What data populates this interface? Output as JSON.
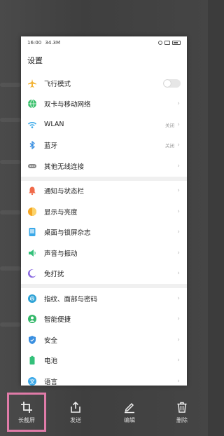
{
  "status_bar": {
    "time": "16:00",
    "extra": "34.3M"
  },
  "page_title": "设置",
  "groups": [
    [
      {
        "icon": "airplane-icon",
        "label": "飞行模式",
        "value": "",
        "control": "toggle",
        "color": "#f2b233"
      },
      {
        "icon": "globe-icon",
        "label": "双卡与移动网络",
        "value": "",
        "control": "chevron",
        "color": "#38c06a"
      },
      {
        "icon": "wifi-icon",
        "label": "WLAN",
        "value": "关闭",
        "control": "chevron",
        "color": "#3aa8e8"
      },
      {
        "icon": "bluetooth-icon",
        "label": "蓝牙",
        "value": "关闭",
        "control": "chevron",
        "color": "#3a8fe0"
      },
      {
        "icon": "more-connections-icon",
        "label": "其他无线连接",
        "value": "",
        "control": "chevron",
        "color": "#888888"
      }
    ],
    [
      {
        "icon": "bell-icon",
        "label": "通知与状态栏",
        "value": "",
        "control": "chevron",
        "color": "#f06a4a"
      },
      {
        "icon": "brightness-icon",
        "label": "显示与亮度",
        "value": "",
        "control": "chevron",
        "color": "#f5a623"
      },
      {
        "icon": "wallpaper-icon",
        "label": "桌面与锁屏杂志",
        "value": "",
        "control": "chevron",
        "color": "#3aa8e8"
      },
      {
        "icon": "speaker-icon",
        "label": "声音与振动",
        "value": "",
        "control": "chevron",
        "color": "#34c07a"
      },
      {
        "icon": "moon-icon",
        "label": "免打扰",
        "value": "",
        "control": "chevron",
        "color": "#8a6ae0"
      }
    ],
    [
      {
        "icon": "fingerprint-icon",
        "label": "指纹、面部与密码",
        "value": "",
        "control": "chevron",
        "color": "#2fa3d6"
      },
      {
        "icon": "smart-assist-icon",
        "label": "智能便捷",
        "value": "",
        "control": "chevron",
        "color": "#34b86a"
      },
      {
        "icon": "shield-icon",
        "label": "安全",
        "value": "",
        "control": "chevron",
        "color": "#3a8fe0"
      },
      {
        "icon": "battery-icon",
        "label": "电池",
        "value": "",
        "control": "chevron",
        "color": "#34c07a"
      },
      {
        "icon": "language-icon",
        "label": "语言",
        "value": "",
        "control": "chevron",
        "color": "#3aa8e8"
      }
    ]
  ],
  "toolbar": [
    {
      "icon": "crop-icon",
      "label": "长截屏",
      "selected": true
    },
    {
      "icon": "share-icon",
      "label": "发送",
      "selected": false
    },
    {
      "icon": "edit-icon",
      "label": "编辑",
      "selected": false
    },
    {
      "icon": "trash-icon",
      "label": "删除",
      "selected": false
    }
  ],
  "colors": {
    "highlight": "#e07ba8",
    "toolbar_bg": "#3c3c3c"
  }
}
